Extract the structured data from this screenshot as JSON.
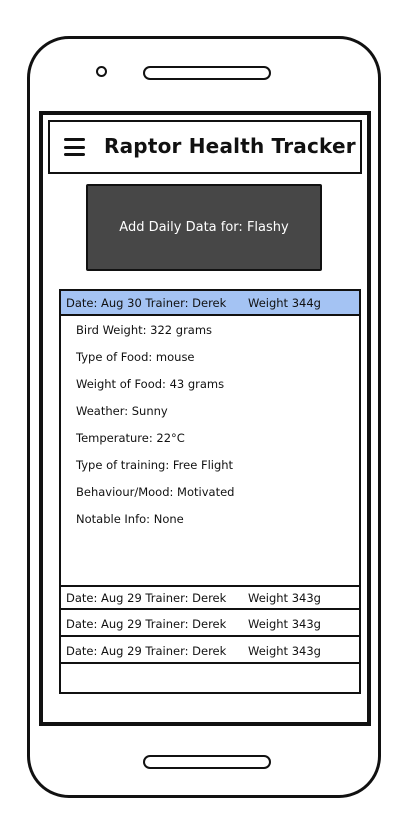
{
  "app": {
    "title": "Raptor Health Tracker"
  },
  "add_button": {
    "label": "Add Daily Data for: Flashy"
  },
  "entries": [
    {
      "date": "Date: Aug 30 Trainer: Derek",
      "weight": "Weight 344g"
    },
    {
      "date": "Date: Aug 29 Trainer: Derek",
      "weight": "Weight 343g"
    },
    {
      "date": "Date: Aug 29 Trainer: Derek",
      "weight": "Weight 343g"
    },
    {
      "date": "Date: Aug 29 Trainer: Derek",
      "weight": "Weight 343g"
    }
  ],
  "details": [
    "Bird Weight: 322 grams",
    "Type of Food: mouse",
    "Weight of Food: 43 grams",
    "Weather: Sunny",
    "Temperature: 22°C",
    "Type of training: Free Flight",
    "Behaviour/Mood: Motivated",
    "Notable Info: None"
  ],
  "colors": {
    "selected_row": "#a4c3f3",
    "button_bg": "#474747"
  }
}
